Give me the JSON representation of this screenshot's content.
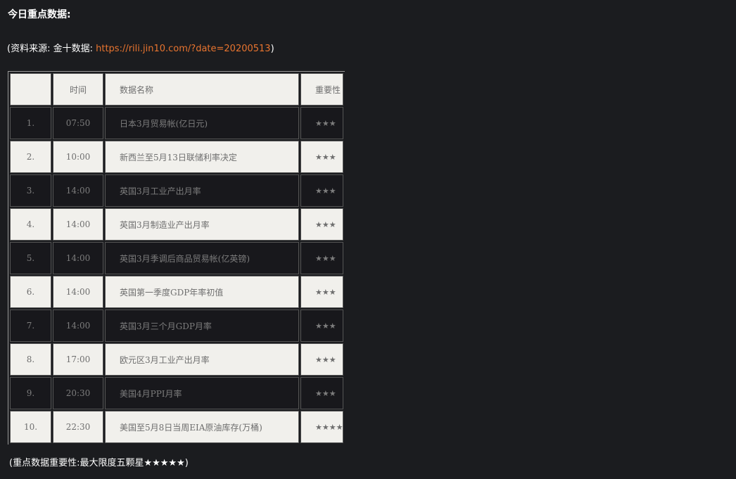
{
  "title": "今日重点数据:",
  "source": {
    "prefix": "(资料来源: 金十数据: ",
    "link_text": "https://rili.jin10.com/?date=20200513",
    "suffix": ")"
  },
  "table": {
    "headers": [
      "",
      "时间",
      "数据名称",
      "重要性"
    ],
    "rows": [
      {
        "num": "1.",
        "time": "07:50",
        "name": "日本3月贸易帐(亿日元)",
        "stars": "★★★"
      },
      {
        "num": "2.",
        "time": "10:00",
        "name": "新西兰至5月13日联储利率决定",
        "stars": "★★★"
      },
      {
        "num": "3.",
        "time": "14:00",
        "name": "英国3月工业产出月率",
        "stars": "★★★"
      },
      {
        "num": "4.",
        "time": "14:00",
        "name": "英国3月制造业产出月率",
        "stars": "★★★"
      },
      {
        "num": "5.",
        "time": "14:00",
        "name": "英国3月季调后商品贸易帐(亿英镑)",
        "stars": "★★★"
      },
      {
        "num": "6.",
        "time": "14:00",
        "name": "英国第一季度GDP年率初值",
        "stars": "★★★"
      },
      {
        "num": "7.",
        "time": "14:00",
        "name": "英国3月三个月GDP月率",
        "stars": "★★★"
      },
      {
        "num": "8.",
        "time": "17:00",
        "name": "欧元区3月工业产出月率",
        "stars": "★★★"
      },
      {
        "num": "9.",
        "time": "20:30",
        "name": "美国4月PPI月率",
        "stars": "★★★"
      },
      {
        "num": "10.",
        "time": "22:30",
        "name": "美国至5月8日当周EIA原油库存(万桶)",
        "stars": "★★★★"
      }
    ]
  },
  "note": "(重点数据重要性:最大限度五颗星★★★★★)"
}
